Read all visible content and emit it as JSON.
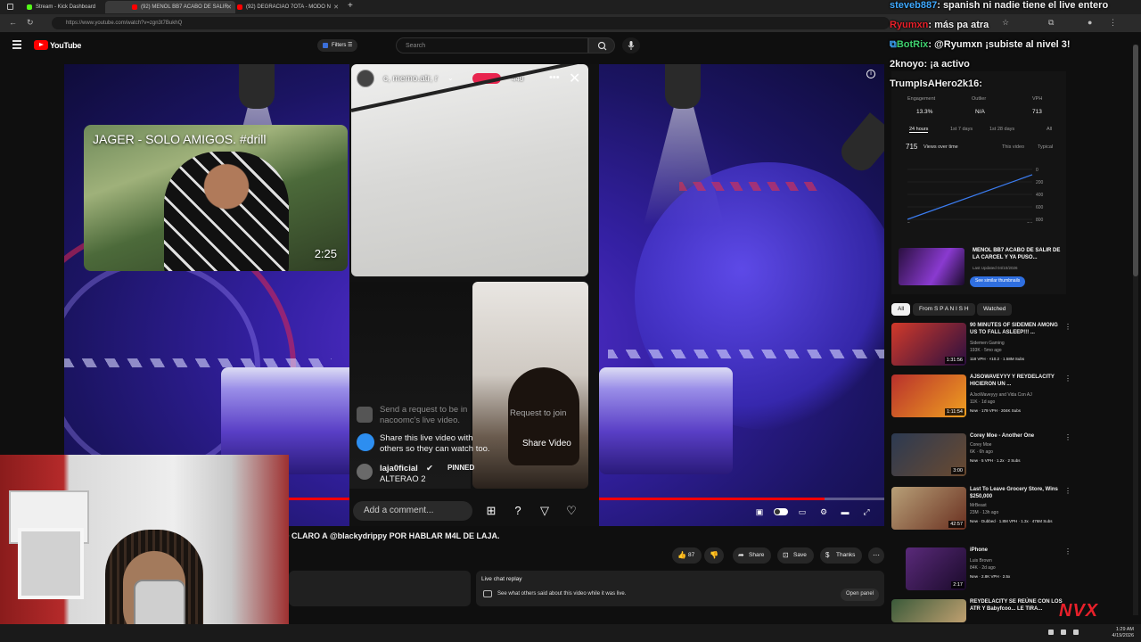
{
  "browser": {
    "tabs": [
      {
        "title": "Stream - Kick Dashboard",
        "color": "#53fc18"
      },
      {
        "title": "(92) MENOL BB7 ACABO DE SALIR",
        "color": "#ff0000"
      },
      {
        "title": "(92) DEGRACIAO 7OTA - MODO N",
        "color": "#ff0000"
      }
    ],
    "url": "https://www.youtube.com/watch?v=zgn3t7BukhQ"
  },
  "youtube": {
    "logo": "YouTube",
    "filters_label": "Filters",
    "search_placeholder": "Search"
  },
  "player": {
    "inset_title": "JAGER - SOLO AMIGOS. #drill",
    "inset_duration": "2:25",
    "progress_fraction": 0.91
  },
  "tiktok": {
    "host": "c, memo.atr, r",
    "viewers": "440",
    "request_text_1": "Send a request to be in",
    "request_text_2": "nacoomc's live video.",
    "share_line_1": "Share this live video with",
    "share_line_2": "others so they can watch too.",
    "pinned_user": "laja0ficial",
    "pinned_label": "PINNED",
    "pinned_message": "ALTERAO 2",
    "request_to_join": "Request to join",
    "share_video": "Share Video",
    "comment_placeholder": "Add a comment..."
  },
  "video": {
    "title": "D CLARO A @blackydrippy POR HABLAR M4L DE LAJA.",
    "likes": "87",
    "share": "Share",
    "save": "Save",
    "thanks": "Thanks",
    "live_chat_title": "Live chat replay",
    "live_chat_text": "See what others said about this video while it was live.",
    "open_panel": "Open panel"
  },
  "analytics": {
    "engagement_label": "Engagement",
    "engagement_value": "13.3%",
    "outlier_label": "Outlier",
    "outlier_value": "N/A",
    "vph_label": "VPH",
    "vph_value": "713",
    "tabs": [
      "24 hours",
      "1st 7 days",
      "1st 28 days",
      "All"
    ],
    "views": "715",
    "views_selector": "Views over time",
    "legend_this": "This video",
    "legend_typical": "Typical",
    "y_ticks": [
      "800",
      "600",
      "400",
      "200",
      "0"
    ],
    "x_ticks": [
      "0",
      "1H"
    ],
    "promo_title": "MENOL BB7 ACABO DE SALIR DE LA CARCEL Y YA PUSO...",
    "promo_updated": "Last Updated 04/10/2026",
    "promo_button": "See similar thumbnails"
  },
  "chat": [
    {
      "user": "steveb887",
      "message": ": spanish ni nadie tiene el live entero",
      "color": "#3fa9ff"
    },
    {
      "user": "Ryumxn",
      "message": ": más pa atra",
      "color": "#e8202a"
    },
    {
      "user": "BotRix",
      "message": ": @Ryumxn ¡subiste al nivel 3!",
      "color": "#3fd16f"
    },
    {
      "user": "2knoyo",
      "message": ": ¡a activo",
      "color": "#ffffff"
    },
    {
      "user": "TrumpIsAHero2k16",
      "message": ":",
      "color": "#ffffff"
    }
  ],
  "filter_chips": [
    "All",
    "From S P A N I S H",
    "Watched"
  ],
  "recommendations": [
    {
      "title": "90 MINUTES OF SIDEMEN AMONG US TO FALL ASLEEP!!! ...",
      "channel": "Sidemen Gaming",
      "meta": "193K · 5mo ago",
      "badges": "118 VPH  ·  ×10.2  ·  1.58M Subs",
      "duration": "1:31:56",
      "thumb": "#d23a2a"
    },
    {
      "title": "AJSOWAVEYYY Y REYDELACITY HICIERON UN ...",
      "channel": "AJsoWaveyyy and Vida Con AJ",
      "meta": "11K · 1d ago",
      "badges": "New  ·  179 VPH  ·  204K Subs",
      "duration": "1:11:54",
      "thumb": "#b8302c"
    },
    {
      "title": "Corey Moe - Another One",
      "channel": "Corey Moe",
      "meta": "6K · 6h ago",
      "badges": "New  ·  5 VPH  ·  1.2x  ·  2 Subs",
      "duration": "3:00",
      "thumb": "#2c3a52"
    },
    {
      "title": "Last To Leave Grocery Store, Wins $250,000",
      "channel": "MrBeast",
      "meta": "23M · 13h ago",
      "badges": "New  ·  Dubbed  ·  1.8M VPH  ·  1.3x  ·  476M Subs",
      "duration": "42:57",
      "thumb": "#b8a078"
    },
    {
      "title": "iPhone",
      "channel": "Luis Brown",
      "meta": "84K · 2d ago",
      "badges": "New  ·  2.8K VPH  ·  2.5x",
      "duration": "2:17",
      "thumb": "#5a2a7a"
    },
    {
      "title": "REYDELACITY SE REÚNE CON LOS ATR Y Babyfcoo... LE TIRA...",
      "channel": "",
      "meta": "",
      "badges": "",
      "duration": "",
      "thumb": "#3a5a3a"
    }
  ],
  "overlay_logo": "NVX",
  "taskbar": {
    "time": "1:29 AM",
    "date": "4/19/2026"
  },
  "chart_data": {
    "type": "line",
    "x": [
      0,
      1
    ],
    "series": [
      {
        "name": "This video",
        "values": [
          0,
          715
        ]
      }
    ],
    "ylim": [
      0,
      800
    ],
    "y_ticks": [
      0,
      200,
      400,
      600,
      800
    ]
  }
}
